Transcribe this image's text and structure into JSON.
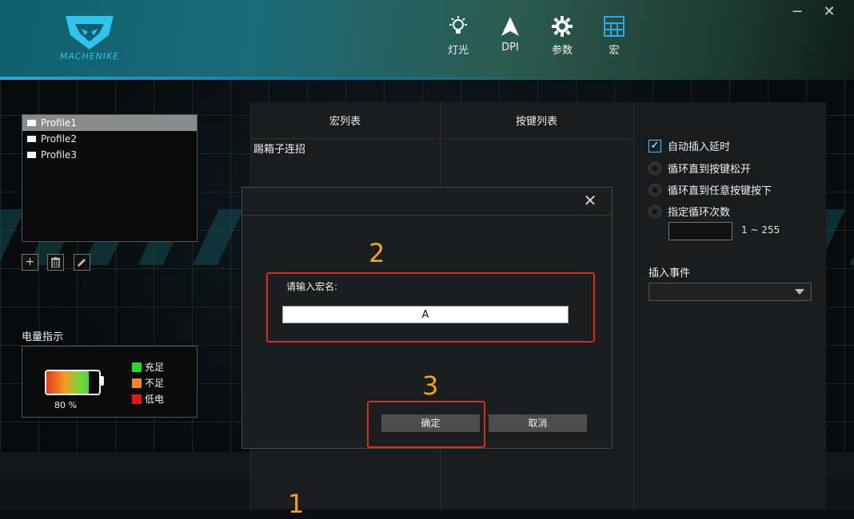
{
  "brand": {
    "name": "MACHENIKE",
    "accent": "#32c0e8"
  },
  "nav": [
    {
      "label": "灯光",
      "icon": "lightbulb-icon"
    },
    {
      "label": "DPI",
      "icon": "cursor-arrow-icon"
    },
    {
      "label": "参数",
      "icon": "gear-icon"
    },
    {
      "label": "宏",
      "icon": "grid-table-icon"
    }
  ],
  "window": {
    "minimize": "−",
    "close": "✕"
  },
  "profiles": {
    "items": [
      "Profile1",
      "Profile2",
      "Profile3"
    ],
    "selected": "Profile1",
    "tools": {
      "add": "+",
      "delete": "🗑",
      "edit": "✎"
    }
  },
  "battery": {
    "title": "电量指示",
    "percent_label": "80 %",
    "level": 0.8,
    "legend": [
      {
        "label": "充足",
        "color": "#22dd22"
      },
      {
        "label": "不足",
        "color": "#f08a1a"
      },
      {
        "label": "低电",
        "color": "#e01a1a"
      }
    ]
  },
  "macro": {
    "macro_list_header": "宏列表",
    "key_list_header": "按键列表",
    "entries": [
      "踢箱子连招"
    ]
  },
  "options": {
    "auto_delay": "自动插入延时",
    "loop_until_release": "循环直到按键松开",
    "loop_until_any_key": "循环直到任意按键按下",
    "loop_count": "指定循环次数",
    "loop_range": "1 ~ 255",
    "insert_event_label": "插入事件",
    "insert_event_value": ""
  },
  "dialog": {
    "close": "✕",
    "prompt": "请输入宏名:",
    "input_value": "A",
    "ok": "确定",
    "cancel": "取消"
  },
  "annotations": {
    "n1": "1",
    "n2": "2",
    "n3": "3",
    "color": "#f2a21c",
    "box_color": "#d82a1e"
  }
}
